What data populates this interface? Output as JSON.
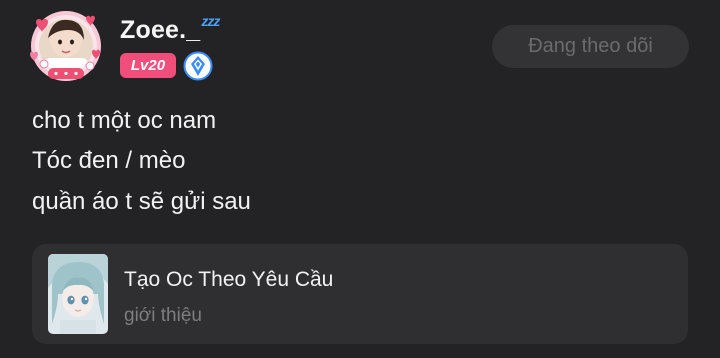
{
  "author": {
    "name": "Zoee._",
    "name_suffix": "zzz",
    "avatar_icon": "avatar-with-hearts-frame",
    "level_badge": "Lv20",
    "verified_icon": "blue-diamond-badge"
  },
  "follow_button": {
    "label": "Đang theo dõi"
  },
  "post": {
    "lines": [
      "cho t một oc nam",
      "Tóc đen / mèo",
      "quần áo t sẽ gửi sau"
    ]
  },
  "linked_card": {
    "title": "Tạo Oc Theo Yêu Cầu",
    "subtitle": "giới thiệu",
    "thumbnail_icon": "anime-character-thumbnail"
  },
  "colors": {
    "background": "#232325",
    "level_badge": "#f24e7b",
    "card_background": "#2f2f32",
    "verified": "#3a8dff"
  }
}
